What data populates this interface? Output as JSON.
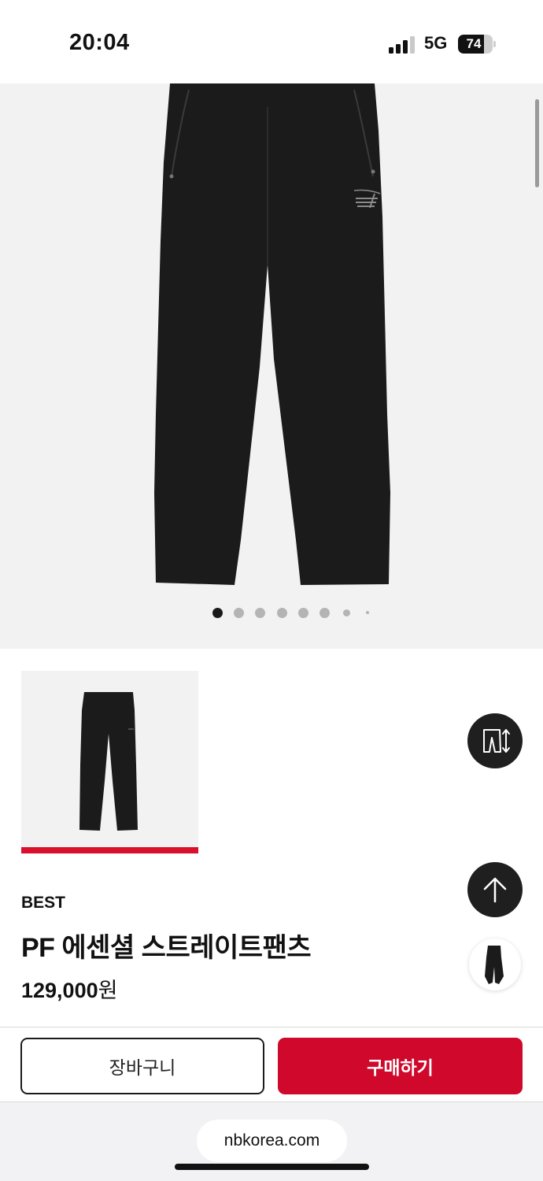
{
  "status_bar": {
    "time": "20:04",
    "network": "5G",
    "battery": "74"
  },
  "hero": {
    "image": "pants-photo",
    "carousel_active_index": 0,
    "carousel_visible_dots": 8
  },
  "thumbnail": {
    "image": "pants-thumbnail",
    "selected": true
  },
  "floating_buttons": {
    "size_icon": "pants-size-icon",
    "top_icon": "arrow-up-icon",
    "recent_icon": "recent-product-icon"
  },
  "product": {
    "badge": "BEST",
    "name": "PF 에센셜 스트레이트팬츠",
    "price": "129,000",
    "currency": "원"
  },
  "actions": {
    "cart_label": "장바구니",
    "buy_label": "구매하기"
  },
  "browser": {
    "url": "nbkorea.com"
  },
  "colors": {
    "accent": "#d0082b",
    "dark": "#1f1f1f",
    "hero_bg": "#f2f2f2"
  }
}
